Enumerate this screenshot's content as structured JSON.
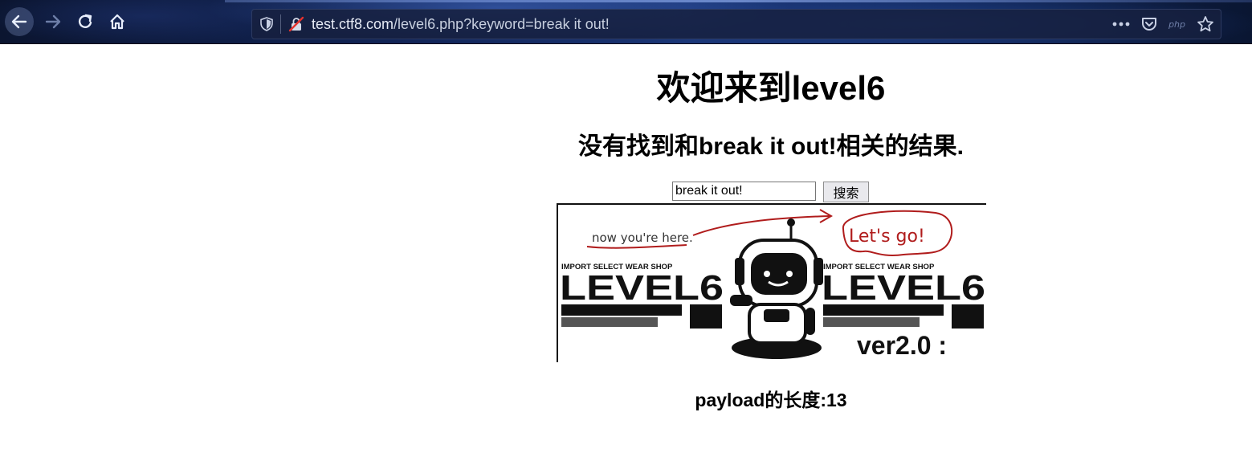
{
  "browser": {
    "url_host": "test.ctf8.com",
    "url_rest": "/level6.php?keyword=break it out!",
    "php_badge": "php",
    "icons": [
      "back-arrow-icon",
      "forward-arrow-icon",
      "reload-icon",
      "home-icon",
      "shield-icon",
      "insecure-lock-icon",
      "more-dots-icon",
      "pocket-icon",
      "star-icon"
    ]
  },
  "page": {
    "title": "欢迎来到level6",
    "result_text": "没有找到和break it out!相关的结果.",
    "search": {
      "value": "break it out!",
      "button_label": "搜索"
    },
    "banner": {
      "annotation_left": "now you're here.",
      "annotation_right": "Let's go!",
      "shop_left": "IMPORT SELECT WEAR SHOP",
      "shop_right": "IMPORT SELECT WEAR SHOP",
      "level_left": "LEVEL6",
      "level_right": "LEVEL6",
      "version": "ver2.0 :"
    },
    "payload_length": "payload的长度:13"
  },
  "colors": {
    "accent_red": "#b01c1c",
    "toolbar_blue": "#12265a"
  }
}
